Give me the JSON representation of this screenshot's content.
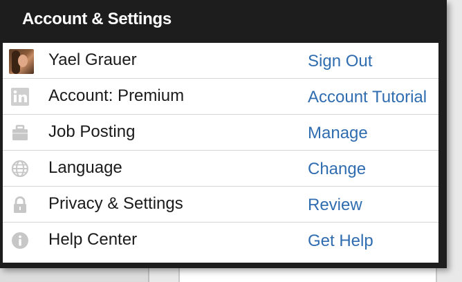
{
  "header": {
    "title": "Account & Settings"
  },
  "rows": [
    {
      "label": "Yael Grauer",
      "action": "Sign Out",
      "icon": "avatar"
    },
    {
      "label": "Account: Premium",
      "action": "Account Tutorial",
      "icon": "linkedin-icon"
    },
    {
      "label": "Job Posting",
      "action": "Manage",
      "icon": "briefcase-icon"
    },
    {
      "label": "Language",
      "action": "Change",
      "icon": "globe-icon"
    },
    {
      "label": "Privacy & Settings",
      "action": "Review",
      "icon": "lock-icon"
    },
    {
      "label": "Help Center",
      "action": "Get Help",
      "icon": "info-icon"
    }
  ],
  "colors": {
    "header_bg": "#1d1d1d",
    "link": "#2f6db0",
    "icon_gray": "#c7c7c7"
  }
}
